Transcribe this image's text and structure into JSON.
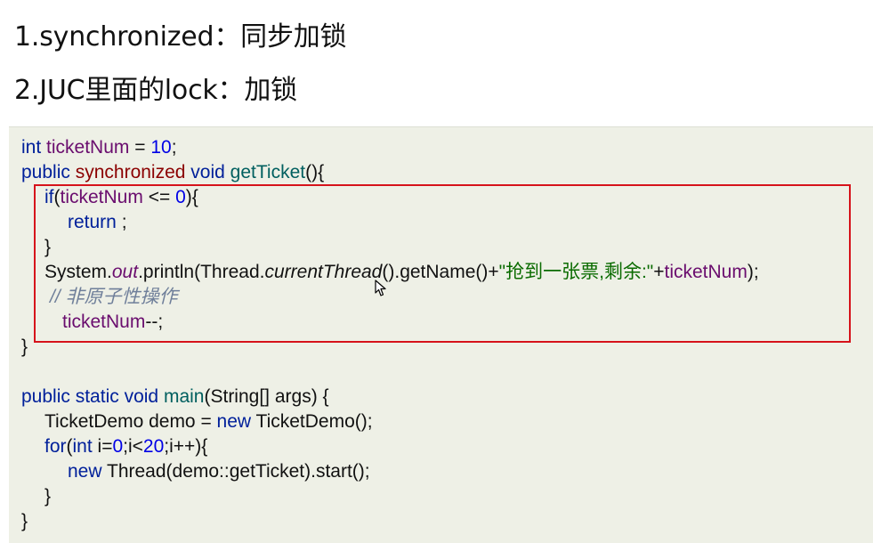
{
  "headings": {
    "item1": "1.synchronized：同步加锁",
    "item2": "2.JUC里面的lock：加锁"
  },
  "code": {
    "l1": {
      "t1": "int",
      "t2": " ",
      "t3": "ticketNum",
      "t4": " = ",
      "t5": "10",
      "t6": ";"
    },
    "l2": {
      "t1": "public",
      "t2": " ",
      "t3": "synchronized",
      "t4": " ",
      "t5": "void",
      "t6": " ",
      "t7": "getTicket",
      "t8": "(){"
    },
    "l3": {
      "t1": "if",
      "t2": "(",
      "t3": "ticketNum",
      "t4": " <= ",
      "t5": "0",
      "t6": "){"
    },
    "l4": {
      "t1": "return",
      "t2": " ;"
    },
    "l5": {
      "t1": "}"
    },
    "l6": {
      "t1": "System.",
      "t2": "out",
      "t3": ".println(Thread.",
      "t4": "currentThread",
      "t5": "().getName()+",
      "t6": "\"抢到一张票,剩余:\"",
      "t7": "+",
      "t8": "ticketNum",
      "t9": ");"
    },
    "l7": {
      "t1": "// 非原子性操作"
    },
    "l8": {
      "t1": "ticketNum",
      "t2": "--;"
    },
    "l9": {
      "t1": "}"
    },
    "l10": {
      "t1": "public",
      "t2": " ",
      "t3": "static",
      "t4": " ",
      "t5": "void",
      "t6": " ",
      "t7": "main",
      "t8": "(String[] args) {"
    },
    "l11": {
      "t1": "TicketDemo demo = ",
      "t2": "new",
      "t3": " TicketDemo();"
    },
    "l12": {
      "t1": "for",
      "t2": "(",
      "t3": "int",
      "t4": " i=",
      "t5": "0",
      "t6": ";i<",
      "t7": "20",
      "t8": ";i++){"
    },
    "l13": {
      "t1": "new",
      "t2": " Thread(demo::getTicket).start();"
    },
    "l14": {
      "t1": "}"
    },
    "l15": {
      "t1": "}"
    }
  },
  "colors": {
    "highlight_border": "#d6131b",
    "code_background": "#eef0e6"
  }
}
